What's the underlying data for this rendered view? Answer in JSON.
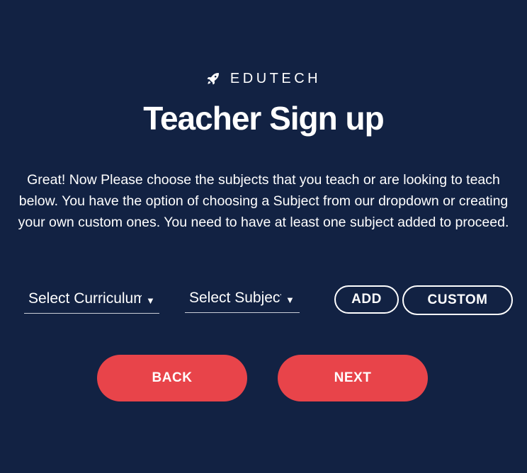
{
  "brand": {
    "icon": "rocket-icon",
    "name": "EDUTECH"
  },
  "page": {
    "title": "Teacher Sign up",
    "description": "Great! Now Please choose the subjects that you teach or are looking to teach below. You have the option of choosing a Subject from our dropdown or creating your own custom ones. You need to have at least one subject added to proceed."
  },
  "form": {
    "curriculum_select": {
      "value": "Select Curriculum",
      "arrow_icon": "caret-down-icon"
    },
    "subject_select": {
      "value": "Select Subject",
      "arrow_icon": "caret-down-icon"
    },
    "add_label": "ADD",
    "custom_label": "CUSTOM"
  },
  "actions": {
    "back_label": "BACK",
    "next_label": "NEXT"
  },
  "colors": {
    "background": "#122243",
    "accent": "#e8444a",
    "text": "#ffffff"
  }
}
